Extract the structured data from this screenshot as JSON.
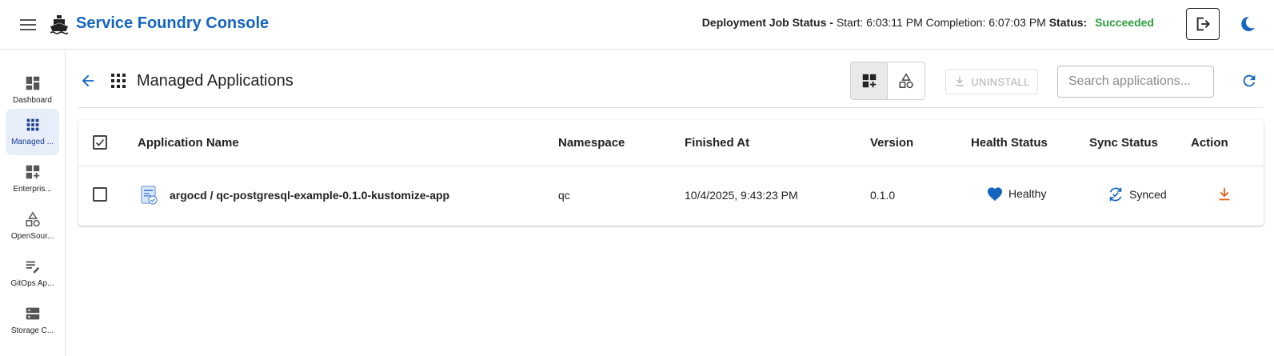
{
  "header": {
    "title": "Service Foundry Console",
    "job_status_label": "Deployment Job Status -",
    "start_text": "Start: 6:03:11 PM",
    "completion_text": "Completion: 6:07:03 PM",
    "status_label": "Status:",
    "status_value": "Succeeded",
    "accent_color": "#1565c0",
    "status_color": "#2e9d3f"
  },
  "sidebar": {
    "items": [
      {
        "label": "Dashboard",
        "icon": "dashboard-icon",
        "active": false
      },
      {
        "label": "Managed ...",
        "icon": "apps-grid-icon",
        "active": true
      },
      {
        "label": "Enterpris...",
        "icon": "add-grid-icon",
        "active": false
      },
      {
        "label": "OpenSour...",
        "icon": "shapes-icon",
        "active": false
      },
      {
        "label": "GitOps Ap...",
        "icon": "edit-list-icon",
        "active": false
      },
      {
        "label": "Storage C...",
        "icon": "storage-icon",
        "active": false
      }
    ]
  },
  "page": {
    "title": "Managed Applications",
    "uninstall_label": "UNINSTALL",
    "search_placeholder": "Search applications..."
  },
  "table": {
    "columns": [
      "Application Name",
      "Namespace",
      "Finished At",
      "Version",
      "Health Status",
      "Sync Status",
      "Action"
    ],
    "rows": [
      {
        "name": "argocd / qc-postgresql-example-0.1.0-kustomize-app",
        "namespace": "qc",
        "finished_at": "10/4/2025, 9:43:23 PM",
        "version": "0.1.0",
        "health": "Healthy",
        "sync": "Synced"
      }
    ]
  }
}
